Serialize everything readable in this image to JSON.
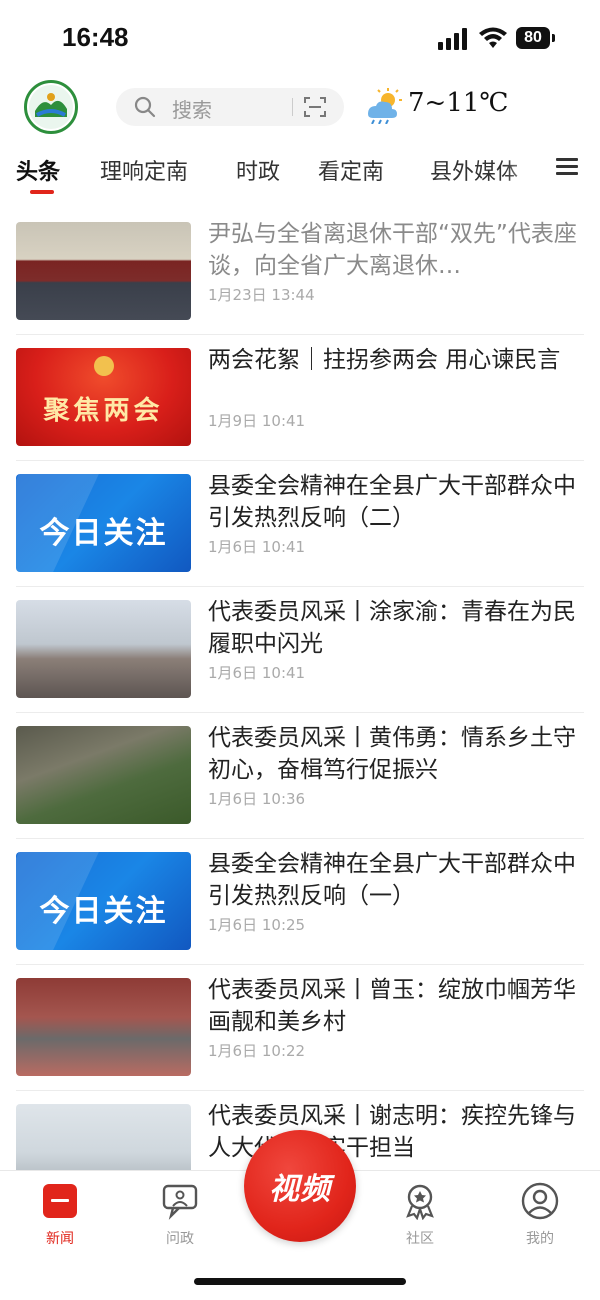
{
  "status_bar": {
    "time": "16:48",
    "battery": "80"
  },
  "header": {
    "search_placeholder": "搜索",
    "weather": "7~11℃"
  },
  "tabs": [
    {
      "label": "头条",
      "active": true
    },
    {
      "label": "理响定南",
      "active": false
    },
    {
      "label": "时政",
      "active": false
    },
    {
      "label": "看定南",
      "active": false
    },
    {
      "label": "县外媒体",
      "active": false
    }
  ],
  "news": [
    {
      "title": "尹弘与全省离退休干部“双先”代表座谈，向全省广大离退休…",
      "date": "1月23日  13:44",
      "thumb_text": "",
      "read": true
    },
    {
      "title": "两会花絮｜拄拐参两会 用心谏民言",
      "date": "1月9日  10:41",
      "thumb_text": "聚焦两会",
      "read": false
    },
    {
      "title": "县委全会精神在全县广大干部群众中引发热烈反响（二）",
      "date": "1月6日  10:41",
      "thumb_text": "今日关注",
      "read": false
    },
    {
      "title": "代表委员风采丨涂家渝：青春在为民履职中闪光",
      "date": "1月6日  10:41",
      "thumb_text": "",
      "read": false
    },
    {
      "title": "代表委员风采丨黄伟勇：情系乡土守初心，奋楫笃行促振兴",
      "date": "1月6日  10:36",
      "thumb_text": "",
      "read": false
    },
    {
      "title": "县委全会精神在全县广大干部群众中引发热烈反响（一）",
      "date": "1月6日  10:25",
      "thumb_text": "今日关注",
      "read": false
    },
    {
      "title": "代表委员风采丨曾玉：绽放巾帼芳华 画靓和美乡村",
      "date": "1月6日  10:22",
      "thumb_text": "",
      "read": false
    },
    {
      "title": "代表委员风采丨谢志明：疾控先锋与人大代表的实干担当",
      "date": "",
      "thumb_text": "",
      "read": false
    }
  ],
  "bottom_nav": {
    "news": "新闻",
    "politics": "问政",
    "video": "视频",
    "community": "社区",
    "mine": "我的"
  },
  "colors": {
    "accent": "#e1251b",
    "read_title": "#8a8a8a"
  }
}
